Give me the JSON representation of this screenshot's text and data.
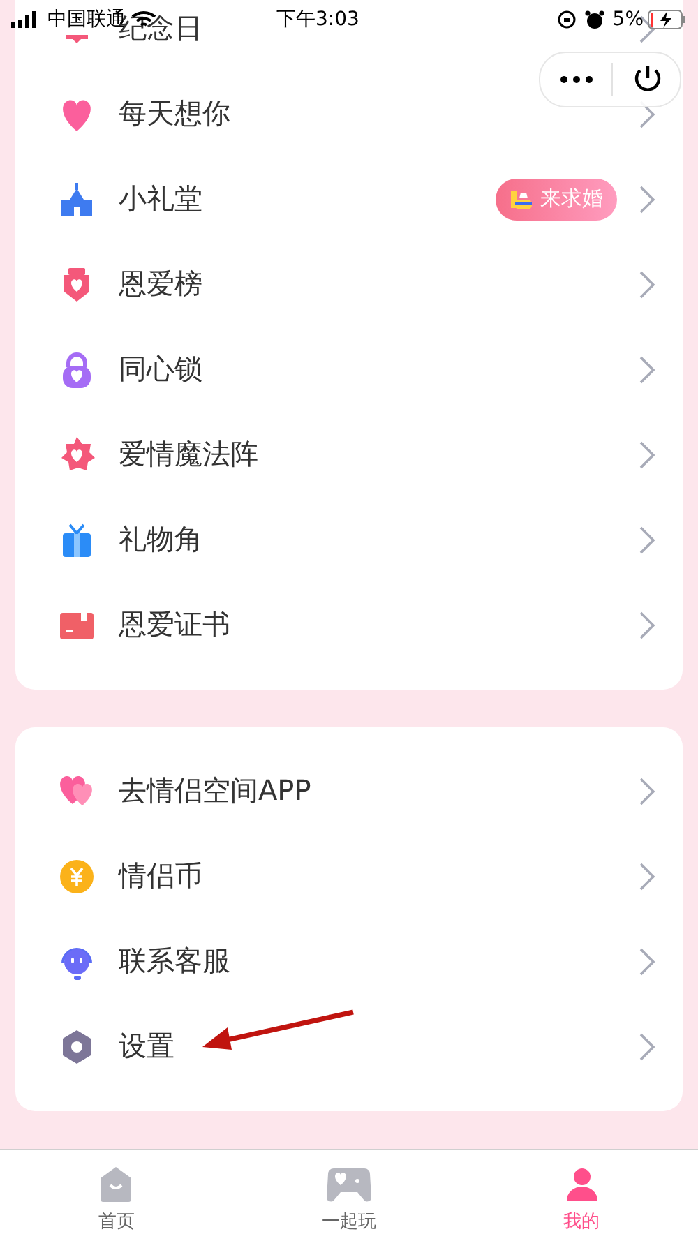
{
  "status_bar": {
    "carrier": "中国联通",
    "time": "下午3:03",
    "battery": "5%"
  },
  "sections": [
    {
      "items": [
        {
          "label": "纪念日"
        },
        {
          "label": "每天想你"
        },
        {
          "label": "小礼堂",
          "badge": "来求婚"
        },
        {
          "label": "恩爱榜"
        },
        {
          "label": "同心锁"
        },
        {
          "label": "爱情魔法阵"
        },
        {
          "label": "礼物角"
        },
        {
          "label": "恩爱证书"
        }
      ]
    },
    {
      "items": [
        {
          "label": "去情侣空间APP"
        },
        {
          "label": "情侣币"
        },
        {
          "label": "联系客服"
        },
        {
          "label": "设置"
        }
      ]
    }
  ],
  "tab_bar": [
    {
      "label": "首页",
      "selected": false
    },
    {
      "label": "一起玩",
      "selected": false
    },
    {
      "label": "我的",
      "selected": true
    }
  ]
}
